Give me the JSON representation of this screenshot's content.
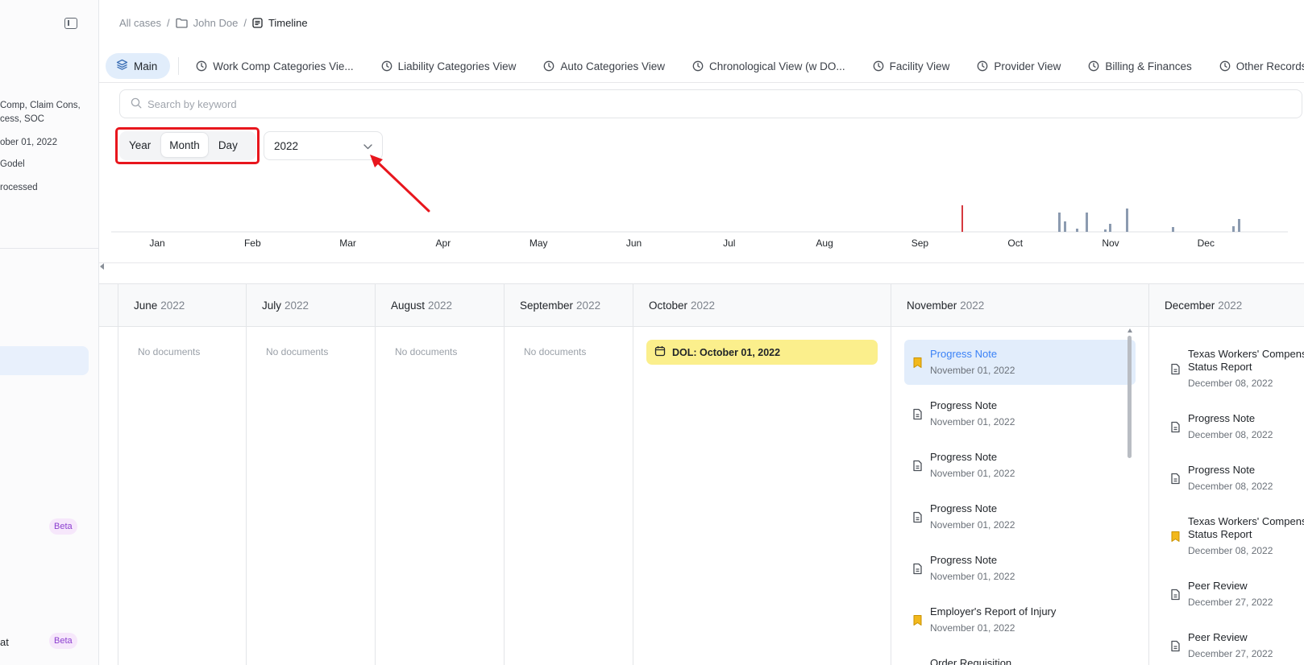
{
  "sidebar": {
    "lines": [
      "Comp, Claim Cons,",
      "cess, SOC",
      "ober 01, 2022",
      "Godel",
      "rocessed"
    ],
    "bottom_item": "at",
    "beta_1": "Beta",
    "beta_2": "Beta"
  },
  "breadcrumb": {
    "root": "All cases",
    "sep": "/",
    "case": "John Doe",
    "current": "Timeline"
  },
  "tabs": [
    "Main",
    "Work Comp Categories Vie...",
    "Liability Categories View",
    "Auto Categories View",
    "Chronological View (w DO...",
    "Facility View",
    "Provider View",
    "Billing & Finances",
    "Other Records"
  ],
  "search": {
    "placeholder": "Search by keyword",
    "value": ""
  },
  "zoom": {
    "options": [
      "Year",
      "Month",
      "Day"
    ],
    "selected": "Month",
    "year": "2022"
  },
  "histogram": {
    "months": [
      "Jan",
      "Feb",
      "Mar",
      "Apr",
      "May",
      "Jun",
      "Jul",
      "Aug",
      "Sep",
      "Oct",
      "Nov",
      "Dec"
    ],
    "marker_color": "#d6393f",
    "bar_color": "#8c9bb0"
  },
  "columns": [
    {
      "month": "June",
      "year": "2022",
      "empty_text": "No documents"
    },
    {
      "month": "July",
      "year": "2022",
      "empty_text": "No documents"
    },
    {
      "month": "August",
      "year": "2022",
      "empty_text": "No documents"
    },
    {
      "month": "September",
      "year": "2022",
      "empty_text": "No documents"
    },
    {
      "month": "October",
      "year": "2022",
      "dol": "DOL: October 01, 2022"
    },
    {
      "month": "November",
      "year": "2022",
      "docs": [
        {
          "title": "Progress Note",
          "date": "November 01, 2022",
          "icon": "bookmark-icon",
          "selected": true
        },
        {
          "title": "Progress Note",
          "date": "November 01, 2022",
          "icon": "document-icon"
        },
        {
          "title": "Progress Note",
          "date": "November 01, 2022",
          "icon": "document-icon"
        },
        {
          "title": "Progress Note",
          "date": "November 01, 2022",
          "icon": "document-icon"
        },
        {
          "title": "Progress Note",
          "date": "November 01, 2022",
          "icon": "document-icon"
        },
        {
          "title": "Employer's Report of Injury",
          "date": "November 01, 2022",
          "icon": "bookmark-icon"
        },
        {
          "title": "Order Requisition",
          "date": "",
          "icon": "document-icon"
        }
      ]
    },
    {
      "month": "December",
      "year": "2022",
      "docs": [
        {
          "title": "Texas Workers' Compens",
          "title2": "Status Report",
          "date": "December 08, 2022",
          "icon": "document-icon"
        },
        {
          "title": "Progress Note",
          "date": "December 08, 2022",
          "icon": "document-icon"
        },
        {
          "title": "Progress Note",
          "date": "December 08, 2022",
          "icon": "document-icon"
        },
        {
          "title": "Texas Workers' Compens",
          "title2": "Status Report",
          "date": "December 08, 2022",
          "icon": "bookmark-icon"
        },
        {
          "title": "Peer Review",
          "date": "December 27, 2022",
          "icon": "document-icon"
        },
        {
          "title": "Peer Review",
          "date": "December 27, 2022",
          "icon": "document-icon"
        }
      ]
    }
  ],
  "colors": {
    "accent": "#3b82f6",
    "highlight": "#e8161d",
    "dol_bg": "#fbef8c",
    "bookmark": "#f2b81c"
  }
}
